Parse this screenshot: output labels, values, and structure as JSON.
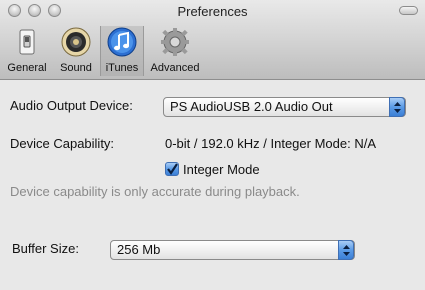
{
  "window": {
    "title": "Preferences"
  },
  "toolbar": {
    "tabs": [
      {
        "label": "General",
        "icon": "switch-icon"
      },
      {
        "label": "Sound",
        "icon": "speaker-icon"
      },
      {
        "label": "iTunes",
        "icon": "music-note-icon"
      },
      {
        "label": "Advanced",
        "icon": "gear-icon"
      }
    ],
    "selected": "iTunes"
  },
  "form": {
    "output_device_label": "Audio Output Device:",
    "output_device_value": "PS AudioUSB 2.0 Audio Out",
    "capability_label": "Device Capability:",
    "capability_value": "0-bit / 192.0 kHz / Integer Mode: N/A",
    "integer_mode_label": "Integer Mode",
    "integer_mode_checked": true,
    "capability_note": "Device capability is only accurate during playback.",
    "buffer_label": "Buffer Size:",
    "buffer_value": "256 Mb"
  },
  "colors": {
    "accent": "#4a8fe0"
  }
}
